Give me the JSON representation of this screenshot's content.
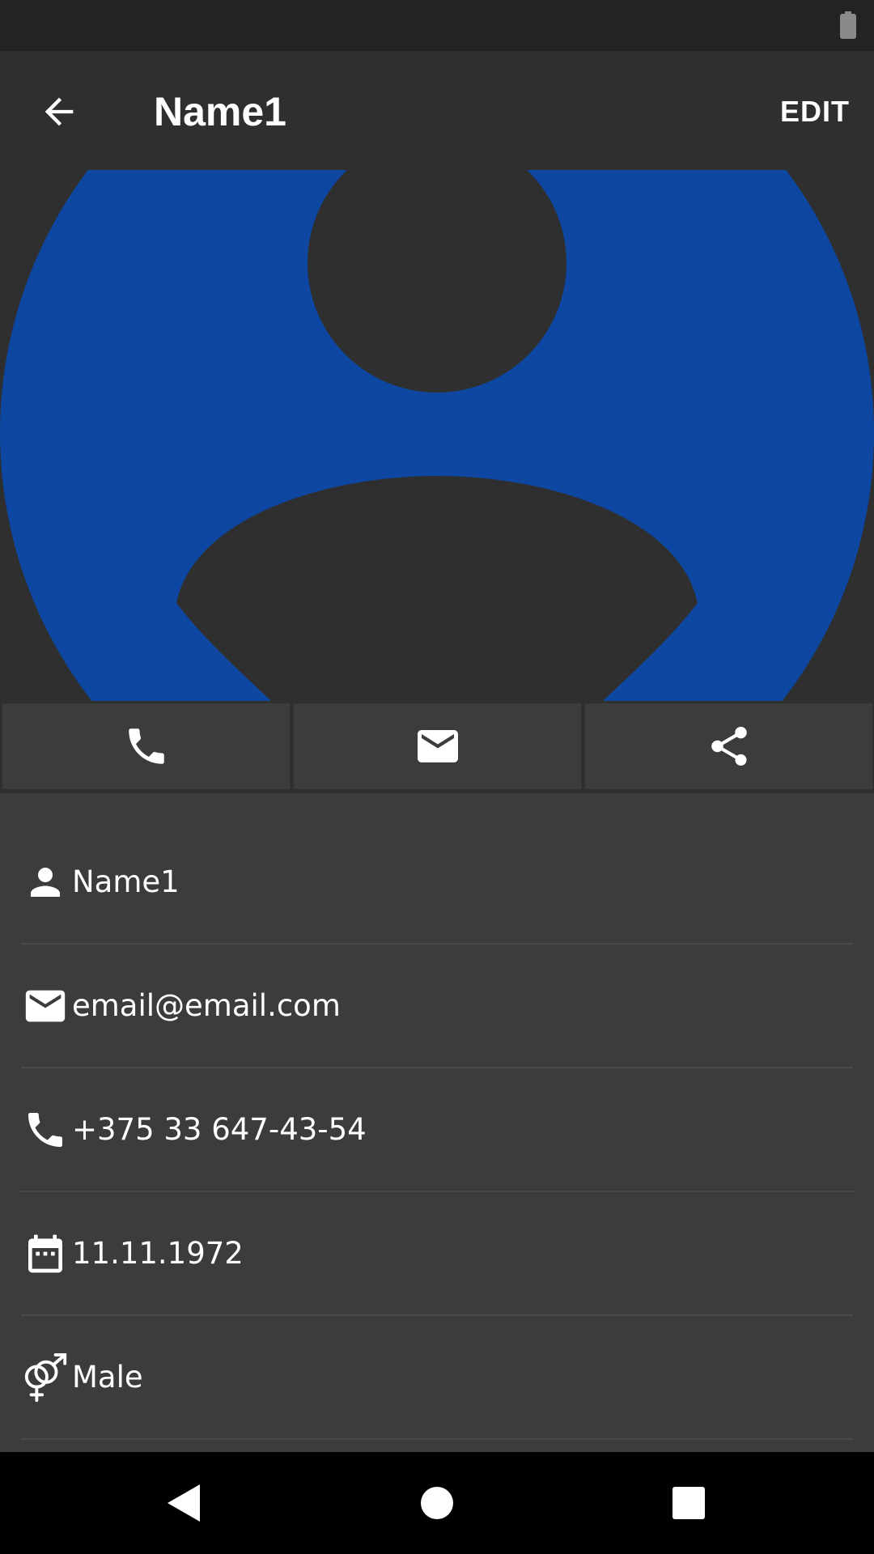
{
  "app_bar": {
    "title": "Name1",
    "edit_label": "EDIT",
    "back_icon": "arrow-left-icon"
  },
  "avatar": {
    "icon": "person-placeholder-icon",
    "color": "#0d47a1"
  },
  "actions": [
    {
      "icon": "phone-icon"
    },
    {
      "icon": "email-icon"
    },
    {
      "icon": "share-icon"
    }
  ],
  "details": {
    "name": "Name1",
    "email": "email@email.com",
    "phone": "+375 33 647-43-54",
    "birthday": "11.11.1972",
    "gender": "Male"
  },
  "colors": {
    "status_bar": "#232323",
    "app_bar": "#2f2f2f",
    "background": "#3c3c3c",
    "accent": "#0d47a1"
  }
}
